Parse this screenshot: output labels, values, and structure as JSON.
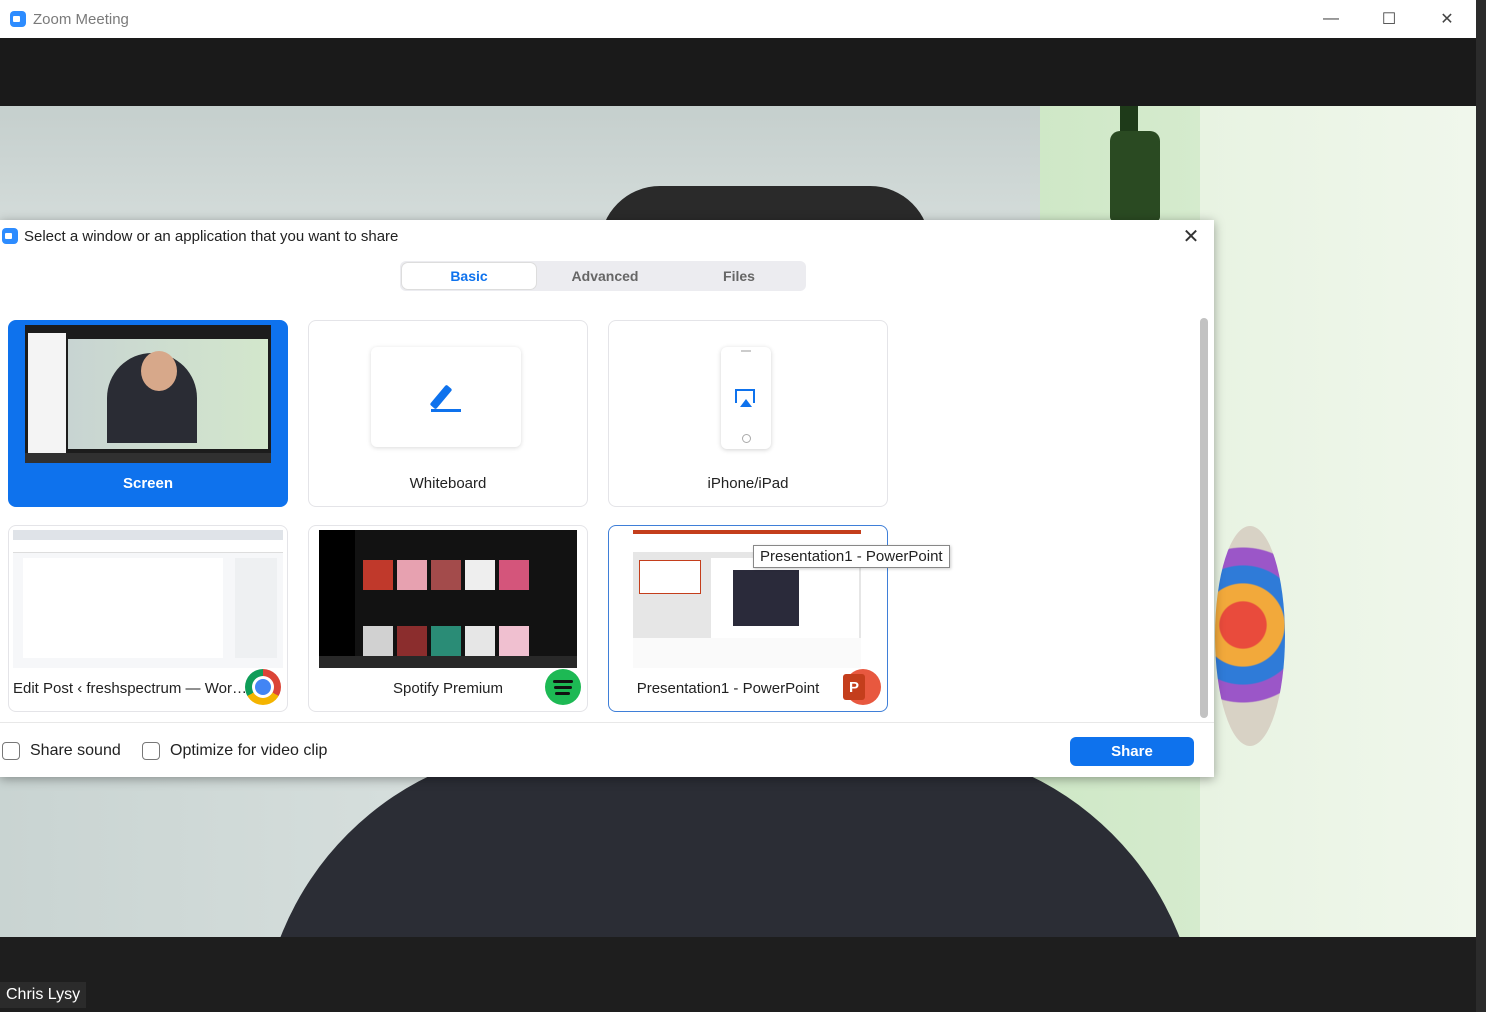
{
  "window": {
    "title": "Zoom Meeting",
    "minimize_glyph": "—",
    "maximize_glyph": "☐",
    "close_glyph": "✕"
  },
  "participant": {
    "name": "Chris Lysy"
  },
  "dialog": {
    "title": "Select a window or an application that you want to share",
    "close_glyph": "✕",
    "tabs": [
      {
        "label": "Basic",
        "active": true
      },
      {
        "label": "Advanced",
        "active": false
      },
      {
        "label": "Files",
        "active": false
      }
    ],
    "tiles": {
      "screen": {
        "label": "Screen",
        "selected": true
      },
      "whiteboard": {
        "label": "Whiteboard",
        "icon": "pencil-icon"
      },
      "iphone": {
        "label": "iPhone/iPad",
        "icon": "airplay-icon"
      },
      "chrome": {
        "label": "Edit Post ‹ freshspectrum — Word...",
        "icon": "chrome-icon"
      },
      "spotify": {
        "label": "Spotify Premium",
        "icon": "spotify-icon"
      },
      "powerpoint": {
        "label": "Presentation1 - PowerPoint",
        "icon": "powerpoint-icon",
        "badge_letter": "P"
      }
    },
    "tooltip": "Presentation1 - PowerPoint",
    "options": {
      "share_sound": {
        "label": "Share sound",
        "checked": false
      },
      "optimize_video": {
        "label": "Optimize for video clip",
        "checked": false
      }
    },
    "share_button": "Share"
  },
  "colors": {
    "accent": "#0e72ed",
    "zoom_blue": "#2d8cff",
    "spotify_green": "#1db954",
    "powerpoint_orange": "#c43e1c"
  }
}
